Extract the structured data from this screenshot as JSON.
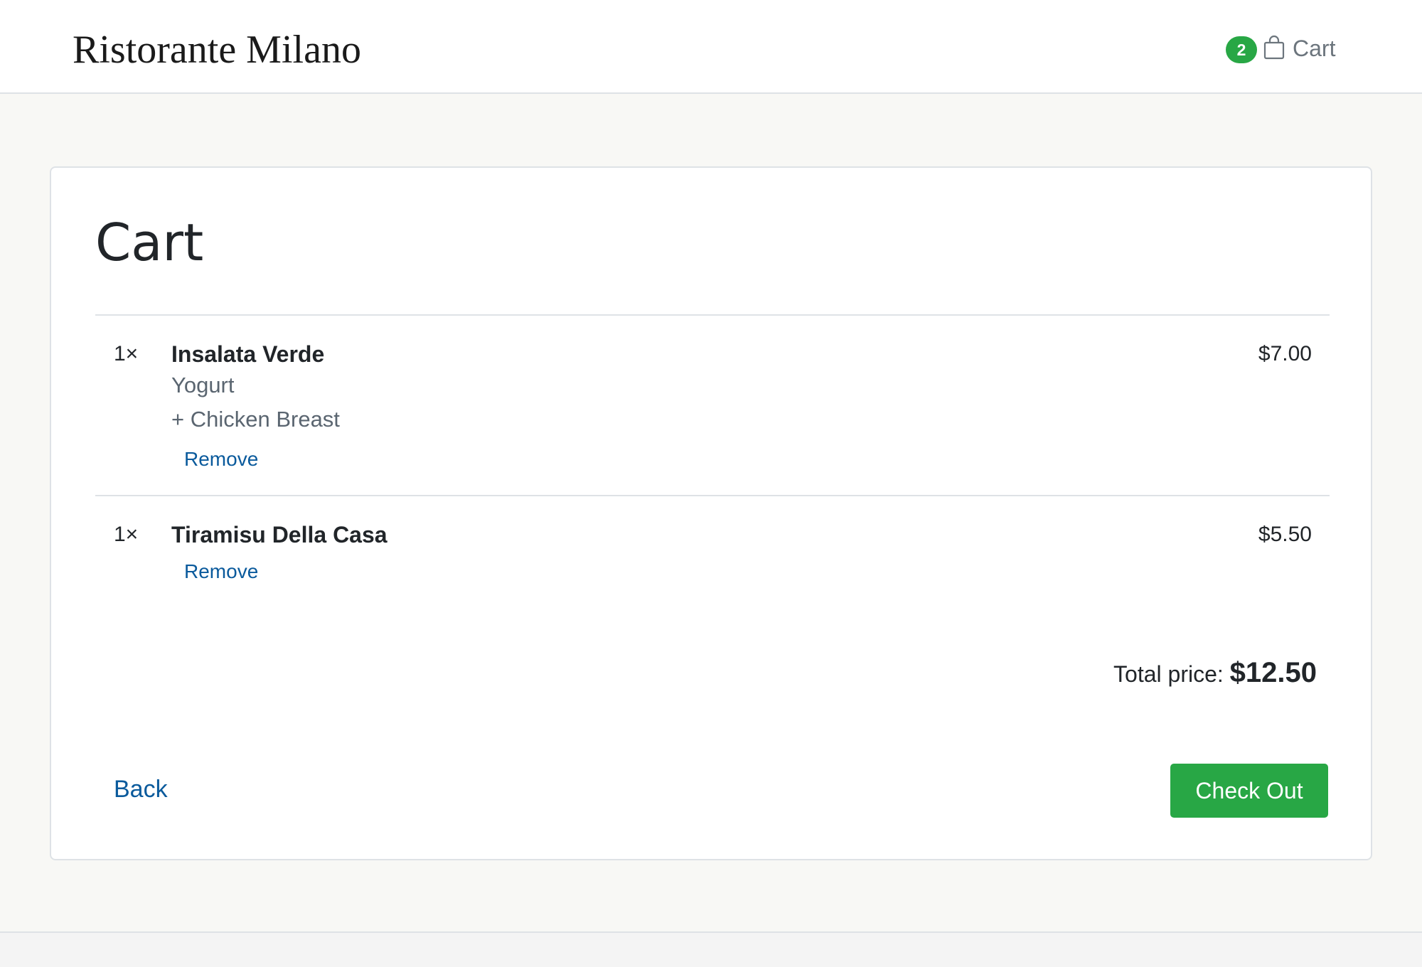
{
  "header": {
    "brand": "Ristorante Milano",
    "cart_count": "2",
    "cart_label": "Cart",
    "cart_icon": "shopping-bag-icon"
  },
  "cart": {
    "title": "Cart",
    "items": [
      {
        "qty": "1×",
        "name": "Insalata Verde",
        "options": [
          "Yogurt",
          "+ Chicken Breast"
        ],
        "price": "$7.00",
        "remove_label": "Remove"
      },
      {
        "qty": "1×",
        "name": "Tiramisu Della Casa",
        "options": [],
        "price": "$5.50",
        "remove_label": "Remove"
      }
    ],
    "total_label": "Total price:",
    "total_value": "$12.50",
    "back_label": "Back",
    "checkout_label": "Check Out"
  },
  "colors": {
    "accent_green": "#28a745",
    "link_blue": "#0a5a9c",
    "page_bg": "#f8f8f5"
  }
}
